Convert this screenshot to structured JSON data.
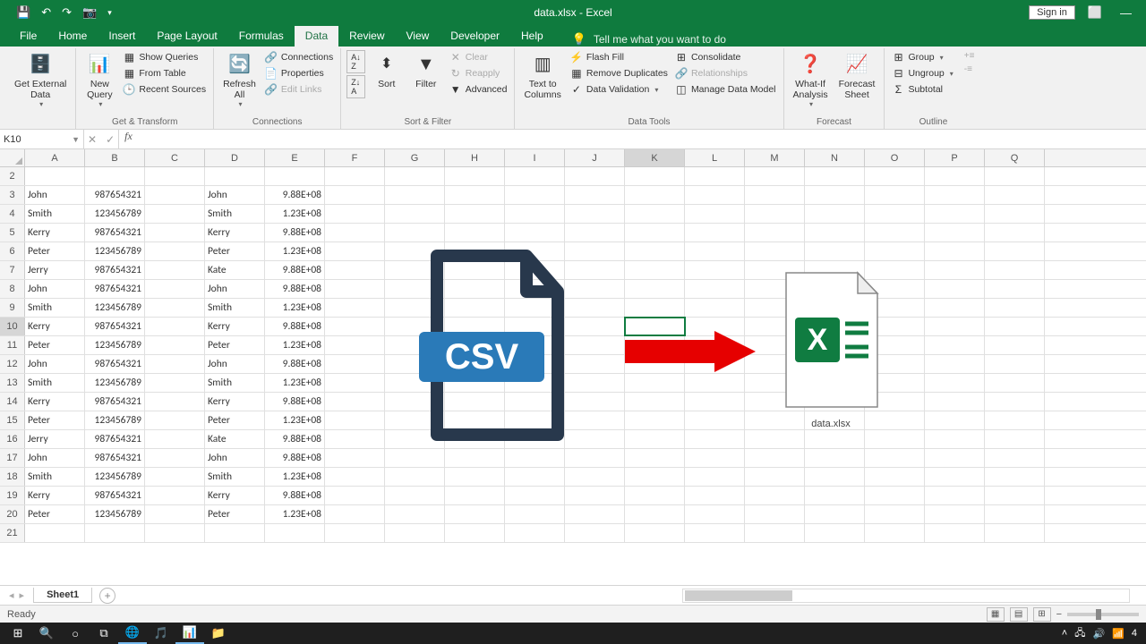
{
  "title": "data.xlsx - Excel",
  "signin": "Sign in",
  "tabs": {
    "file": "File",
    "home": "Home",
    "insert": "Insert",
    "pagelayout": "Page Layout",
    "formulas": "Formulas",
    "data": "Data",
    "review": "Review",
    "view": "View",
    "developer": "Developer",
    "help": "Help",
    "tellme": "Tell me what you want to do"
  },
  "ribbon": {
    "getexternal": {
      "label": "Get External\nData",
      "btn": "Get External\nData"
    },
    "gettransform": {
      "label": "Get & Transform",
      "newquery": "New\nQuery",
      "showqueries": "Show Queries",
      "fromtable": "From Table",
      "recentsources": "Recent Sources"
    },
    "connections": {
      "label": "Connections",
      "refreshall": "Refresh\nAll",
      "connections": "Connections",
      "properties": "Properties",
      "editlinks": "Edit Links"
    },
    "sortfilter": {
      "label": "Sort & Filter",
      "sort": "Sort",
      "filter": "Filter",
      "clear": "Clear",
      "reapply": "Reapply",
      "advanced": "Advanced"
    },
    "datatools": {
      "label": "Data Tools",
      "texttocolumns": "Text to\nColumns",
      "flashfill": "Flash Fill",
      "removedups": "Remove Duplicates",
      "datavalidation": "Data Validation",
      "consolidate": "Consolidate",
      "relationships": "Relationships",
      "managedatamodel": "Manage Data Model"
    },
    "forecast": {
      "label": "Forecast",
      "whatif": "What-If\nAnalysis",
      "forecastsheet": "Forecast\nSheet"
    },
    "outline": {
      "label": "Outline",
      "group": "Group",
      "ungroup": "Ungroup",
      "subtotal": "Subtotal"
    }
  },
  "namebox": "K10",
  "cols": [
    "A",
    "B",
    "C",
    "D",
    "E",
    "F",
    "G",
    "H",
    "I",
    "J",
    "K",
    "L",
    "M",
    "N",
    "O",
    "P",
    "Q"
  ],
  "activecol": "K",
  "activerow": 10,
  "rows": [
    {
      "n": 2,
      "A": "",
      "B": "",
      "D": "",
      "E": ""
    },
    {
      "n": 3,
      "A": "John",
      "B": "987654321",
      "D": "John",
      "E": "9.88E+08"
    },
    {
      "n": 4,
      "A": "Smith",
      "B": "123456789",
      "D": "Smith",
      "E": "1.23E+08"
    },
    {
      "n": 5,
      "A": "Kerry",
      "B": "987654321",
      "D": "Kerry",
      "E": "9.88E+08"
    },
    {
      "n": 6,
      "A": "Peter",
      "B": "123456789",
      "D": "Peter",
      "E": "1.23E+08"
    },
    {
      "n": 7,
      "A": "Jerry",
      "B": "987654321",
      "D": "Kate",
      "E": "9.88E+08"
    },
    {
      "n": 8,
      "A": "John",
      "B": "987654321",
      "D": "John",
      "E": "9.88E+08"
    },
    {
      "n": 9,
      "A": "Smith",
      "B": "123456789",
      "D": "Smith",
      "E": "1.23E+08"
    },
    {
      "n": 10,
      "A": "Kerry",
      "B": "987654321",
      "D": "Kerry",
      "E": "9.88E+08"
    },
    {
      "n": 11,
      "A": "Peter",
      "B": "123456789",
      "D": "Peter",
      "E": "1.23E+08"
    },
    {
      "n": 12,
      "A": "John",
      "B": "987654321",
      "D": "John",
      "E": "9.88E+08"
    },
    {
      "n": 13,
      "A": "Smith",
      "B": "123456789",
      "D": "Smith",
      "E": "1.23E+08"
    },
    {
      "n": 14,
      "A": "Kerry",
      "B": "987654321",
      "D": "Kerry",
      "E": "9.88E+08"
    },
    {
      "n": 15,
      "A": "Peter",
      "B": "123456789",
      "D": "Peter",
      "E": "1.23E+08"
    },
    {
      "n": 16,
      "A": "Jerry",
      "B": "987654321",
      "D": "Kate",
      "E": "9.88E+08"
    },
    {
      "n": 17,
      "A": "John",
      "B": "987654321",
      "D": "John",
      "E": "9.88E+08"
    },
    {
      "n": 18,
      "A": "Smith",
      "B": "123456789",
      "D": "Smith",
      "E": "1.23E+08"
    },
    {
      "n": 19,
      "A": "Kerry",
      "B": "987654321",
      "D": "Kerry",
      "E": "9.88E+08"
    },
    {
      "n": 20,
      "A": "Peter",
      "B": "123456789",
      "D": "Peter",
      "E": "1.23E+08"
    },
    {
      "n": 21,
      "A": "",
      "B": "",
      "D": "",
      "E": ""
    }
  ],
  "sheettab": "Sheet1",
  "overlay_label": "data.xlsx",
  "status": "Ready",
  "csv_badge": "CSV",
  "tray_time": "4"
}
